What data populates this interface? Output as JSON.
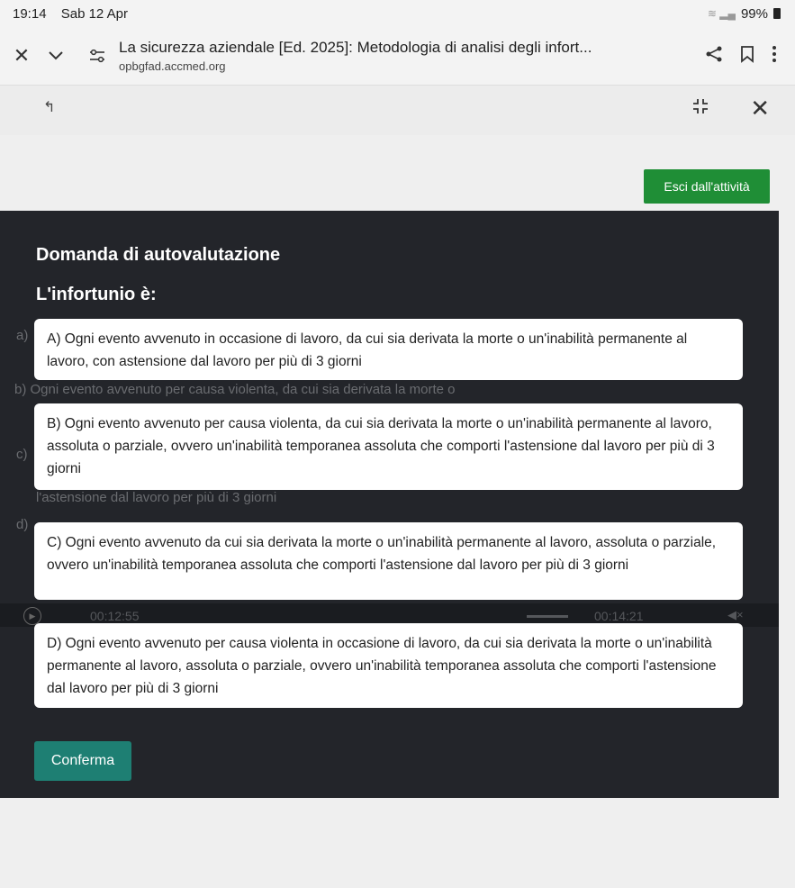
{
  "status": {
    "time": "19:14",
    "date": "Sab 12 Apr",
    "battery": "99%"
  },
  "tab": {
    "title": "La sicurezza aziendale [Ed. 2025]: Metodologia di analisi degli infort...",
    "url": "opbgfad.accmed.org"
  },
  "activity": {
    "exit_label": "Esci dall'attività"
  },
  "quiz": {
    "heading": "Domanda di autovalutazione",
    "question": "L'infortunio è:",
    "options": [
      {
        "label": "A) Ogni evento avvenuto in occasione di lavoro, da cui sia derivata la morte o un'inabilità permanente al lavoro, con astensione dal lavoro per più di 3 giorni"
      },
      {
        "label": "B) Ogni evento avvenuto per causa violenta, da cui sia derivata la morte o un'inabilità permanente al lavoro, assoluta o parziale, ovvero un'inabilità temporanea assoluta che comporti l'astensione dal lavoro per più di 3 giorni"
      },
      {
        "label": "C) Ogni evento avvenuto da cui sia derivata la morte o un'inabilità permanente al lavoro, assoluta o parziale, ovvero un'inabilità temporanea assoluta che comporti l'astensione dal lavoro per più di 3 giorni"
      },
      {
        "label": "D) Ogni evento avvenuto per causa violenta in occasione di lavoro, da cui sia derivata la morte o un'inabilità permanente al lavoro, assoluta o parziale, ovvero un'inabilità temporanea assoluta che comporti l'astensione dal lavoro per più di 3 giorni"
      }
    ],
    "confirm_label": "Conferma"
  },
  "background": {
    "letter_a": "a)",
    "letter_b": "b)",
    "letter_c": "c)",
    "letter_d": "d)",
    "text_b": "Ogni evento avvenuto per causa violenta, da cui sia derivata la morte o",
    "text_astensione": "l'astensione dal lavoro per più di 3 giorni"
  },
  "video": {
    "current_time": "00:12:55",
    "total_time": "00:14:21"
  },
  "colors": {
    "exit_button": "#1f8e36",
    "confirm_button": "#1e7f73",
    "panel": "#23252a"
  }
}
